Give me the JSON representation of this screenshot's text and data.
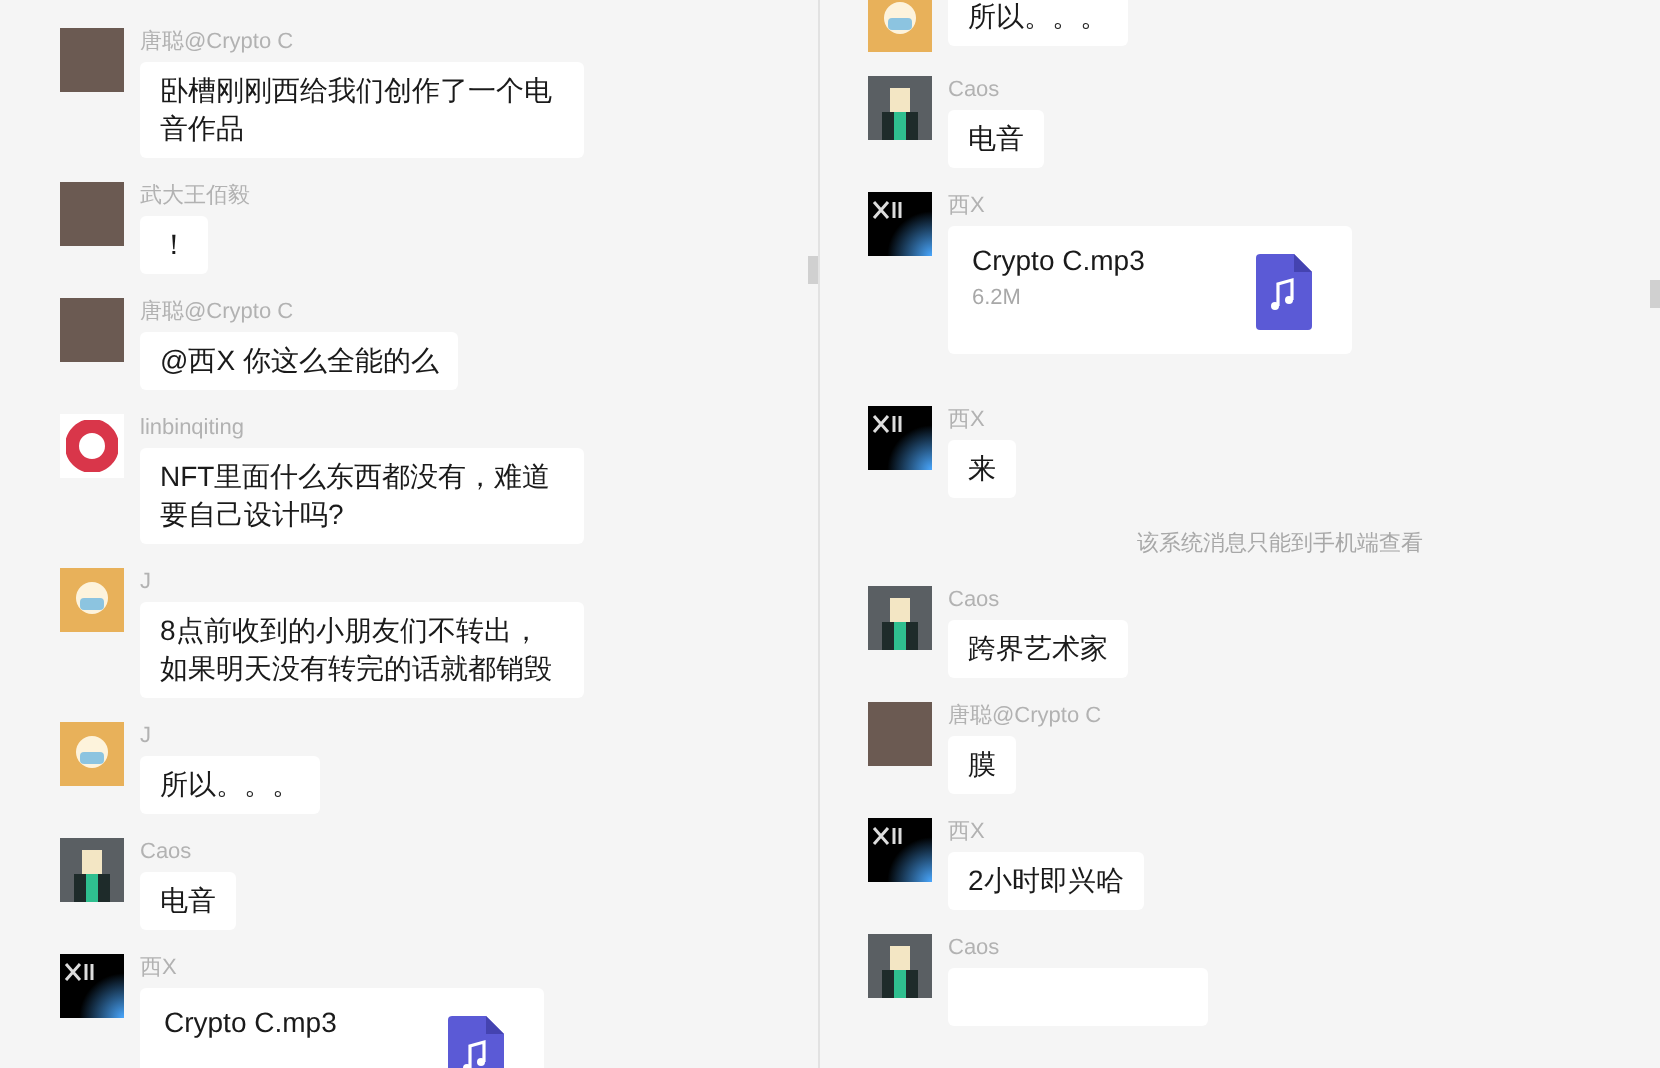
{
  "panels": [
    {
      "messages": [
        {
          "kind": "text",
          "sender": "唐聪@Crypto C",
          "avatar": {
            "kind": "photo"
          },
          "text": "卧槽刚刚西给我们创作了一个电音作品"
        },
        {
          "kind": "text",
          "sender": "武大王佰毅",
          "avatar": {
            "kind": "photo"
          },
          "text": "！"
        },
        {
          "kind": "text",
          "sender": "唐聪@Crypto C",
          "avatar": {
            "kind": "photo"
          },
          "text": "@西X 你这么全能的么"
        },
        {
          "kind": "text",
          "sender": "linbinqiting",
          "avatar": {
            "kind": "donut"
          },
          "text": "NFT里面什么东西都没有，难道要自己设计吗?"
        },
        {
          "kind": "text",
          "sender": "J",
          "avatar": {
            "kind": "cartoon"
          },
          "text": "8点前收到的小朋友们不转出，如果明天没有转完的话就都销毁"
        },
        {
          "kind": "text",
          "sender": "J",
          "avatar": {
            "kind": "cartoon"
          },
          "text": "所以。。。"
        },
        {
          "kind": "text",
          "sender": "Caos",
          "avatar": {
            "kind": "figure"
          },
          "text": "电音"
        },
        {
          "kind": "file",
          "sender": "西X",
          "avatar": {
            "kind": "logo"
          },
          "file_name": "Crypto C.mp3"
        }
      ]
    },
    {
      "messages": [
        {
          "kind": "text",
          "avatar": {
            "kind": "cartoon"
          },
          "text": "所以。。。"
        },
        {
          "kind": "text",
          "sender": "Caos",
          "avatar": {
            "kind": "figure"
          },
          "text": "电音"
        },
        {
          "kind": "file",
          "sender": "西X",
          "avatar": {
            "kind": "logo"
          },
          "file_name": "Crypto C.mp3",
          "file_size": "6.2M"
        },
        {
          "kind": "text",
          "sender": "西X",
          "avatar": {
            "kind": "logo"
          },
          "text": "来"
        },
        {
          "kind": "system",
          "text": "该系统消息只能到手机端查看"
        },
        {
          "kind": "text",
          "sender": "Caos",
          "avatar": {
            "kind": "figure"
          },
          "text": "跨界艺术家"
        },
        {
          "kind": "text",
          "sender": "唐聪@Crypto C",
          "avatar": {
            "kind": "photo"
          },
          "text": "膜"
        },
        {
          "kind": "text",
          "sender": "西X",
          "avatar": {
            "kind": "logo"
          },
          "text": "2小时即兴哈"
        },
        {
          "kind": "text",
          "sender": "Caos",
          "avatar": {
            "kind": "figure"
          }
        }
      ]
    }
  ]
}
